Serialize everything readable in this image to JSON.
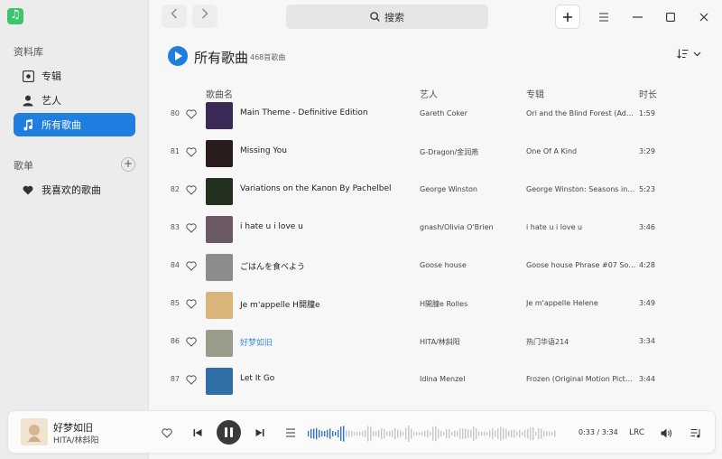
{
  "sidebar": {
    "library_heading": "资料库",
    "library_items": [
      {
        "label": "专辑",
        "icon": "album-icon",
        "active": false
      },
      {
        "label": "艺人",
        "icon": "artist-icon",
        "active": false
      },
      {
        "label": "所有歌曲",
        "icon": "music-note-icon",
        "active": true
      }
    ],
    "playlist_heading": "歌单",
    "playlist_items": [
      {
        "label": "我喜欢的歌曲",
        "icon": "heart-icon"
      }
    ]
  },
  "toolbar": {
    "search_label": "搜索"
  },
  "page": {
    "title": "所有歌曲",
    "count": "468首歌曲"
  },
  "columns": {
    "title": "歌曲名",
    "artist": "艺人",
    "album": "专辑",
    "duration": "时长"
  },
  "songs": [
    {
      "num": "80",
      "title": "Main Theme - Definitive Edition",
      "artist": "Gareth Coker",
      "album": "Ori and the Blind Forest (Additio...",
      "duration": "1:59",
      "cover": "#3b2a55"
    },
    {
      "num": "81",
      "title": "Missing You",
      "artist": "G-Dragon/金润燕",
      "album": "One Of A Kind",
      "duration": "3:29",
      "cover": "#2a1c1c"
    },
    {
      "num": "82",
      "title": "Variations on the Kanon By Pachelbel",
      "artist": "George Winston",
      "album": "George Winston: Seasons in Con...",
      "duration": "5:23",
      "cover": "#24301f"
    },
    {
      "num": "83",
      "title": "i hate u i love u",
      "artist": "gnash/Olivia O'Brien",
      "album": "i hate u i love u",
      "duration": "3:46",
      "cover": "#6b5a63"
    },
    {
      "num": "84",
      "title": "ごはんを食べよう",
      "artist": "Goose house",
      "album": "Goose house Phrase #07 Soundtr...",
      "duration": "4:28",
      "cover": "#8c8c8c"
    },
    {
      "num": "85",
      "title": "Je m'appelle H開朣e",
      "artist": "H開朣e Rolles",
      "album": "Je m'appelle Helene",
      "duration": "3:49",
      "cover": "#d9b57a"
    },
    {
      "num": "86",
      "title": "好梦如旧",
      "artist": "HITA/林斜阳",
      "album": "热门华语214",
      "duration": "3:34",
      "cover": "#9c9c8c",
      "playing": true
    },
    {
      "num": "87",
      "title": "Let It Go",
      "artist": "Idina Menzel",
      "album": "Frozen (Original Motion Picture ...",
      "duration": "3:44",
      "cover": "#2f6fa8"
    }
  ],
  "player": {
    "title": "好梦如旧",
    "artist": "HITA/林斜阳",
    "time": "0:33 / 3:34",
    "lrc_label": "LRC",
    "progress": 0.154
  }
}
